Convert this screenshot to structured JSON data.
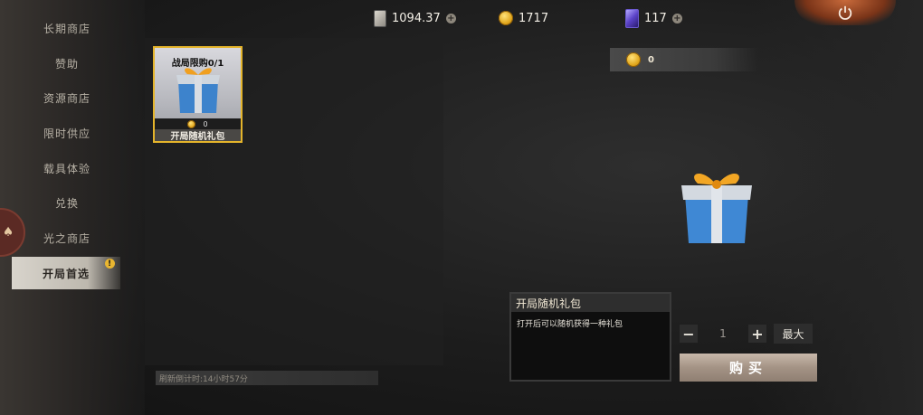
{
  "sidebar": {
    "items": [
      {
        "label": "长期商店"
      },
      {
        "label": "赞助"
      },
      {
        "label": "资源商店"
      },
      {
        "label": "限时供应"
      },
      {
        "label": "载具体验"
      },
      {
        "label": "兑换"
      },
      {
        "label": "光之商店"
      },
      {
        "label": "开局首选",
        "active": true,
        "alert": "!"
      }
    ]
  },
  "currency": {
    "cards": "1094.37",
    "coins": "1717",
    "crystals": "117",
    "plus": "+"
  },
  "item": {
    "limit": "战局限购0/1",
    "price": "0",
    "name": "开局随机礼包"
  },
  "refresh": "刷新倒计时:14小时57分",
  "detail": {
    "cost": "0",
    "title": "开局随机礼包",
    "description": "打开后可以随机获得一种礼包"
  },
  "purchase": {
    "minus": "−",
    "quantity": "1",
    "plus": "+",
    "max_label": "最大",
    "buy_label": "购买"
  },
  "colors": {
    "highlight_border": "#e4b42b",
    "coin_gold": "#e0a51a"
  }
}
